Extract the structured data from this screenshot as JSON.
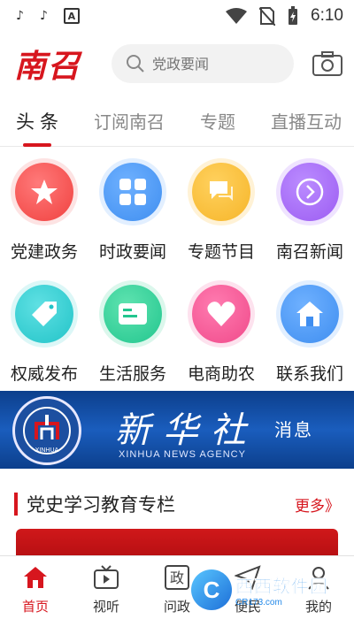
{
  "status_bar": {
    "time": "6:10",
    "app_icon_a": "A"
  },
  "header": {
    "logo": "南召",
    "search_placeholder": "党政要闻"
  },
  "tabs": [
    {
      "label": "头条",
      "active": true
    },
    {
      "label": "订阅南召",
      "active": false
    },
    {
      "label": "专题",
      "active": false
    },
    {
      "label": "直播互动",
      "active": false
    }
  ],
  "grid": [
    {
      "label": "党建政务",
      "icon": "star-icon",
      "color": "#f0413f"
    },
    {
      "label": "时政要闻",
      "icon": "apps-icon",
      "color": "#3f8ef0"
    },
    {
      "label": "专题节目",
      "icon": "chat-icon",
      "color": "#f6b529"
    },
    {
      "label": "南召新闻",
      "icon": "arrow-right-icon",
      "color": "#9c5cf2"
    },
    {
      "label": "权威发布",
      "icon": "tag-icon",
      "color": "#22c4c8"
    },
    {
      "label": "生活服务",
      "icon": "card-icon",
      "color": "#22c68e"
    },
    {
      "label": "电商助农",
      "icon": "heart-icon",
      "color": "#f04a8a"
    },
    {
      "label": "联系我们",
      "icon": "home-icon",
      "color": "#3f8ef0"
    }
  ],
  "banner": {
    "title": "新华社",
    "subtitle": "消息",
    "english": "XINHUA NEWS AGENCY",
    "emblem_text": "XINHUA"
  },
  "section": {
    "title": "党史学习教育专栏",
    "more": "更多》"
  },
  "bottom_nav": [
    {
      "label": "首页",
      "icon": "home-icon",
      "active": true
    },
    {
      "label": "视听",
      "icon": "tv-icon",
      "active": false
    },
    {
      "label": "问政",
      "icon": "politics-icon",
      "active": false
    },
    {
      "label": "便民",
      "icon": "send-icon",
      "active": false
    },
    {
      "label": "我的",
      "icon": "user-icon",
      "active": false
    }
  ],
  "watermark": {
    "main": "西西软件园",
    "url": "CR173.com"
  },
  "colors": {
    "brand_red": "#d7161e"
  }
}
